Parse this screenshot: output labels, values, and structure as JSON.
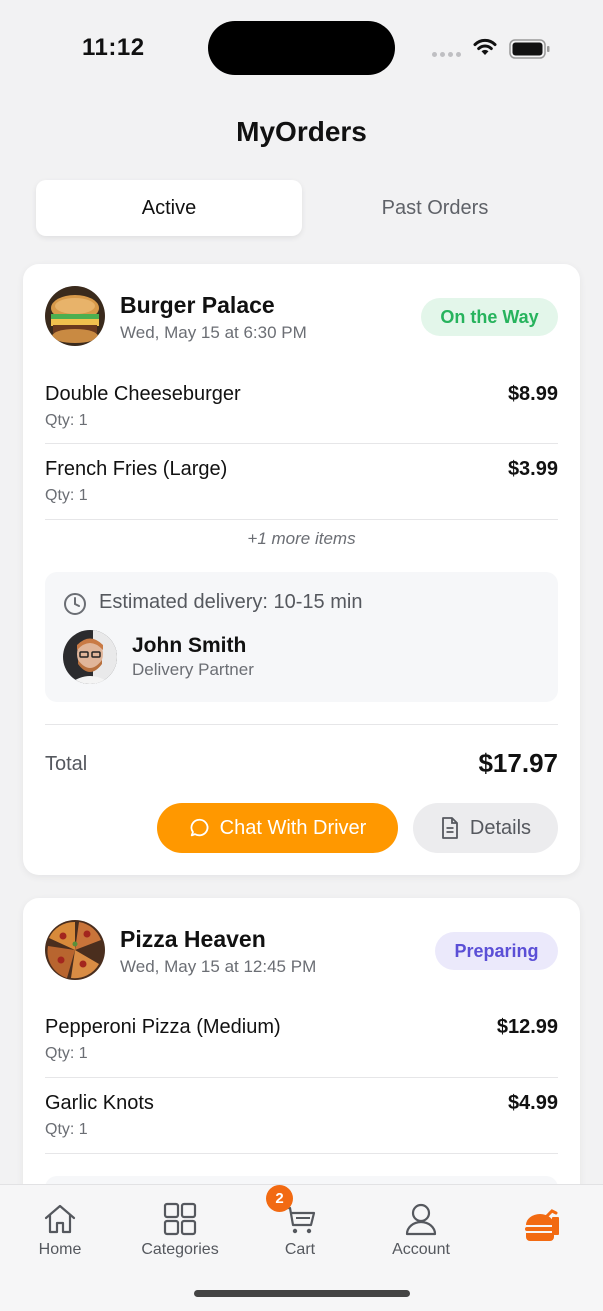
{
  "status_bar": {
    "time": "11:12"
  },
  "header": {
    "title": "MyOrders"
  },
  "segmented": {
    "active": "Active",
    "past": "Past Orders"
  },
  "orders": [
    {
      "restaurant": "Burger Palace",
      "date": "Wed, May 15 at 6:30 PM",
      "status": "On the Way",
      "items": [
        {
          "name": "Double Cheeseburger",
          "qty": "Qty: 1",
          "price": "$8.99"
        },
        {
          "name": "French Fries (Large)",
          "qty": "Qty: 1",
          "price": "$3.99"
        }
      ],
      "more_items": "+1 more items",
      "eta": "Estimated delivery: 10-15 min",
      "driver": {
        "name": "John Smith",
        "role": "Delivery Partner"
      },
      "total_label": "Total",
      "total": "$17.97",
      "chat_label": "Chat With Driver",
      "details_label": "Details"
    },
    {
      "restaurant": "Pizza Heaven",
      "date": "Wed, May 15 at 12:45 PM",
      "status": "Preparing",
      "items": [
        {
          "name": "Pepperoni Pizza (Medium)",
          "qty": "Qty: 1",
          "price": "$12.99"
        },
        {
          "name": "Garlic Knots",
          "qty": "Qty: 1",
          "price": "$4.99"
        }
      ]
    }
  ],
  "tab_bar": {
    "home": "Home",
    "categories": "Categories",
    "cart": "Cart",
    "cart_count": "2",
    "account": "Account"
  },
  "colors": {
    "accent": "#ff9800",
    "status_on_the_way": "#27b35d",
    "status_preparing": "#5b4fd6",
    "cart_badge": "#f26a12"
  },
  "icons": [
    "wifi-icon",
    "battery-icon",
    "clock-icon",
    "chat-icon",
    "document-icon",
    "home-icon",
    "grid-icon",
    "cart-icon",
    "user-icon",
    "burger-logo-icon"
  ]
}
